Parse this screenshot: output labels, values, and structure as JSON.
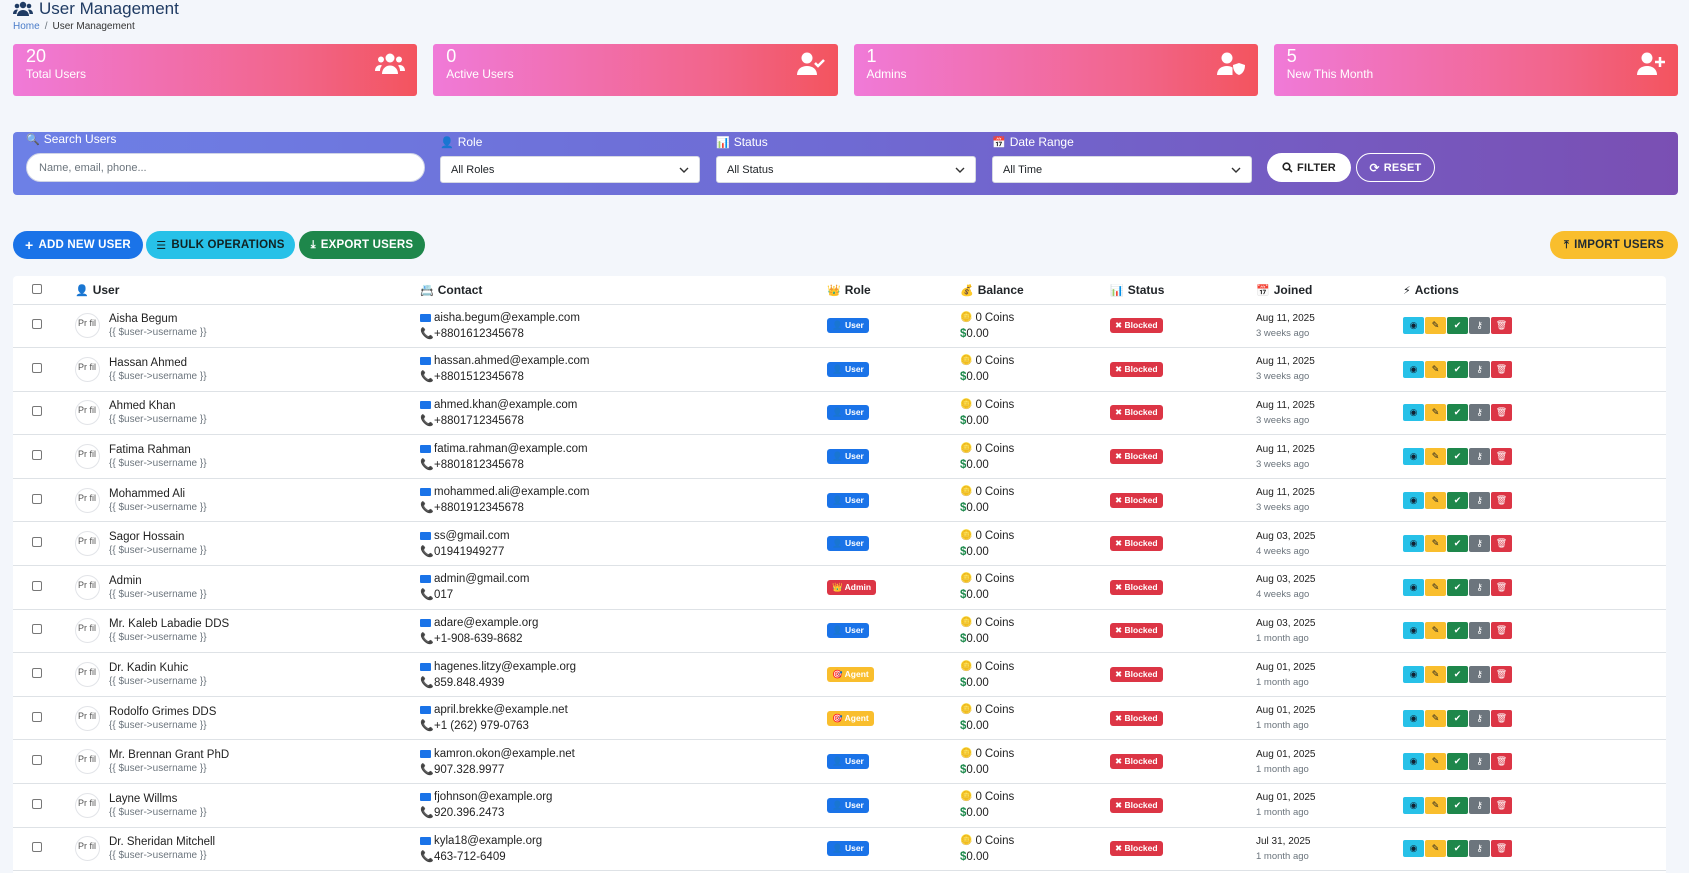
{
  "header": {
    "title": "User Management",
    "breadcrumb": {
      "home": "Home",
      "current": "User Management"
    }
  },
  "stats": [
    {
      "value": "20",
      "label": "Total Users",
      "icon": "users-icon"
    },
    {
      "value": "0",
      "label": "Active Users",
      "icon": "user-check-icon"
    },
    {
      "value": "1",
      "label": "Admins",
      "icon": "user-shield-icon"
    },
    {
      "value": "5",
      "label": "New This Month",
      "icon": "user-plus-icon"
    }
  ],
  "filters": {
    "search_label": "Search Users",
    "search_placeholder": "Name, email, phone...",
    "role_label": "Role",
    "role_value": "All Roles",
    "status_label": "Status",
    "status_value": "All Status",
    "date_label": "Date Range",
    "date_value": "All Time",
    "filter_btn": "FILTER",
    "reset_btn": "RESET"
  },
  "actions": {
    "add": "ADD NEW USER",
    "bulk": "BULK OPERATIONS",
    "export": "EXPORT USERS",
    "import": "IMPORT USERS"
  },
  "table": {
    "columns": [
      "User",
      "Contact",
      "Role",
      "Balance",
      "Status",
      "Joined",
      "Actions"
    ],
    "avatar_alt": "Pr fil",
    "handle_template": "{{ $user->username }}",
    "coins_suffix": "Coins",
    "rows": [
      {
        "name": "Aisha Begum",
        "email": "aisha.begum@example.com",
        "phone": "+8801612345678",
        "role": "User",
        "coins": "0",
        "money": "$0.00",
        "status": "Blocked",
        "date": "Aug 11, 2025",
        "ago": "3 weeks ago"
      },
      {
        "name": "Hassan Ahmed",
        "email": "hassan.ahmed@example.com",
        "phone": "+8801512345678",
        "role": "User",
        "coins": "0",
        "money": "$0.00",
        "status": "Blocked",
        "date": "Aug 11, 2025",
        "ago": "3 weeks ago"
      },
      {
        "name": "Ahmed Khan",
        "email": "ahmed.khan@example.com",
        "phone": "+8801712345678",
        "role": "User",
        "coins": "0",
        "money": "$0.00",
        "status": "Blocked",
        "date": "Aug 11, 2025",
        "ago": "3 weeks ago"
      },
      {
        "name": "Fatima Rahman",
        "email": "fatima.rahman@example.com",
        "phone": "+8801812345678",
        "role": "User",
        "coins": "0",
        "money": "$0.00",
        "status": "Blocked",
        "date": "Aug 11, 2025",
        "ago": "3 weeks ago"
      },
      {
        "name": "Mohammed Ali",
        "email": "mohammed.ali@example.com",
        "phone": "+8801912345678",
        "role": "User",
        "coins": "0",
        "money": "$0.00",
        "status": "Blocked",
        "date": "Aug 11, 2025",
        "ago": "3 weeks ago"
      },
      {
        "name": "Sagor Hossain",
        "email": "ss@gmail.com",
        "phone": "01941949277",
        "role": "User",
        "coins": "0",
        "money": "$0.00",
        "status": "Blocked",
        "date": "Aug 03, 2025",
        "ago": "4 weeks ago"
      },
      {
        "name": "Admin",
        "email": "admin@gmail.com",
        "phone": "017",
        "role": "Admin",
        "coins": "0",
        "money": "$0.00",
        "status": "Blocked",
        "date": "Aug 03, 2025",
        "ago": "4 weeks ago"
      },
      {
        "name": "Mr. Kaleb Labadie DDS",
        "email": "adare@example.org",
        "phone": "+1-908-639-8682",
        "role": "User",
        "coins": "0",
        "money": "$0.00",
        "status": "Blocked",
        "date": "Aug 03, 2025",
        "ago": "1 month ago"
      },
      {
        "name": "Dr. Kadin Kuhic",
        "email": "hagenes.litzy@example.org",
        "phone": "859.848.4939",
        "role": "Agent",
        "coins": "0",
        "money": "$0.00",
        "status": "Blocked",
        "date": "Aug 01, 2025",
        "ago": "1 month ago"
      },
      {
        "name": "Rodolfo Grimes DDS",
        "email": "april.brekke@example.net",
        "phone": "+1 (262) 979-0763",
        "role": "Agent",
        "coins": "0",
        "money": "$0.00",
        "status": "Blocked",
        "date": "Aug 01, 2025",
        "ago": "1 month ago"
      },
      {
        "name": "Mr. Brennan Grant PhD",
        "email": "kamron.okon@example.net",
        "phone": "907.328.9977",
        "role": "User",
        "coins": "0",
        "money": "$0.00",
        "status": "Blocked",
        "date": "Aug 01, 2025",
        "ago": "1 month ago"
      },
      {
        "name": "Layne Willms",
        "email": "fjohnson@example.org",
        "phone": "920.396.2473",
        "role": "User",
        "coins": "0",
        "money": "$0.00",
        "status": "Blocked",
        "date": "Aug 01, 2025",
        "ago": "1 month ago"
      },
      {
        "name": "Dr. Sheridan Mitchell",
        "email": "kyla18@example.org",
        "phone": "463-712-6409",
        "role": "User",
        "coins": "0",
        "money": "$0.00",
        "status": "Blocked",
        "date": "Jul 31, 2025",
        "ago": "1 month ago"
      }
    ]
  },
  "colors": {
    "primary": "#1a73e8",
    "info": "#27c1e8",
    "success": "#1e874b",
    "warning": "#f9be2d",
    "danger": "#dc3545",
    "secondary": "#6c757d"
  }
}
